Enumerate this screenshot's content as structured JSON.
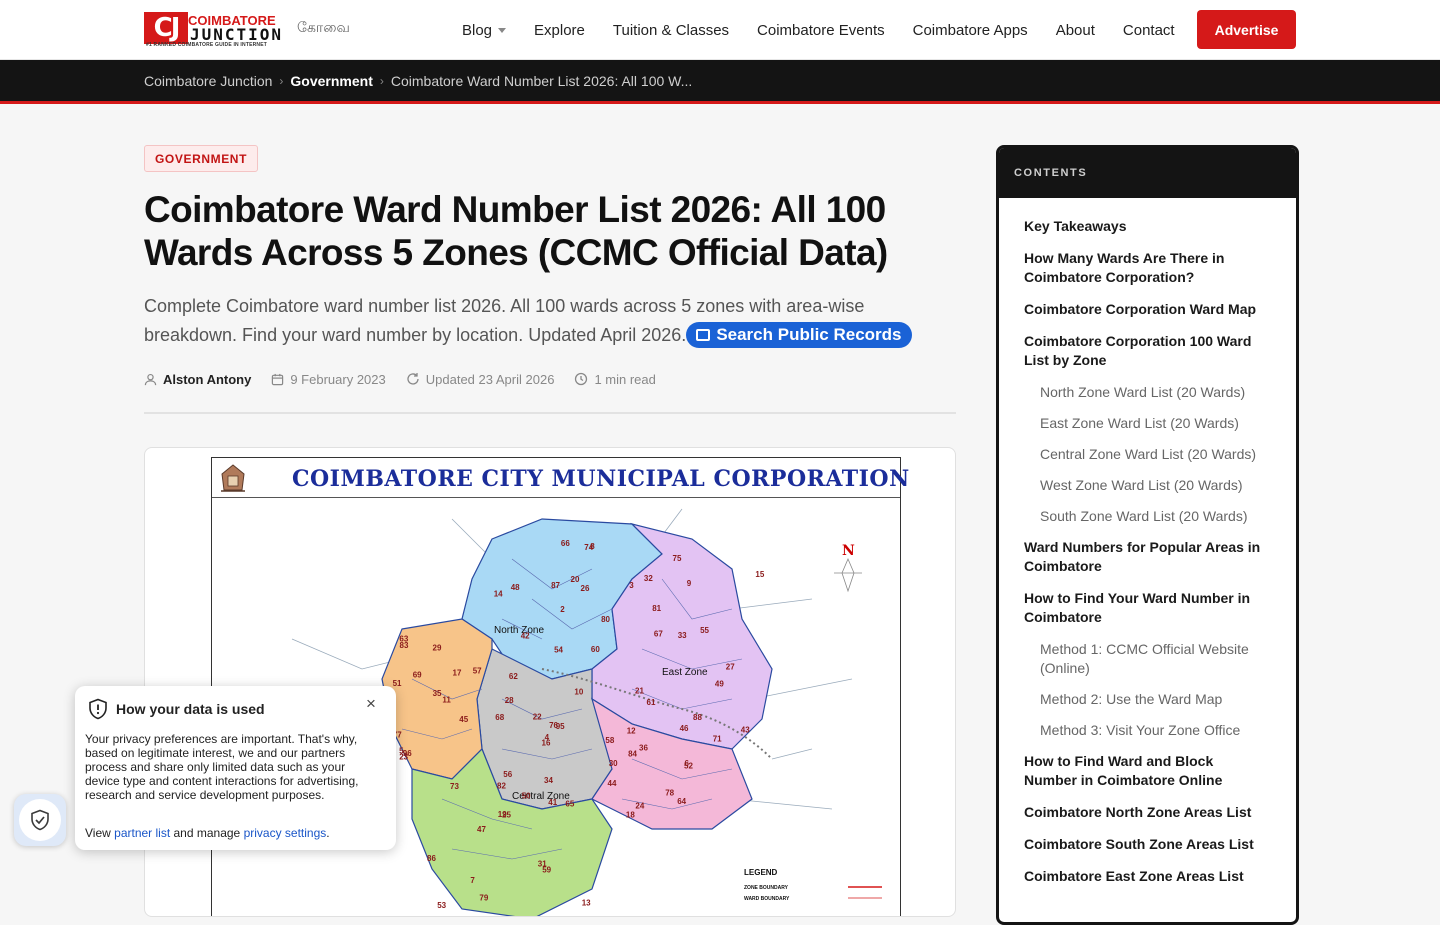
{
  "header": {
    "logo_top": "COIMBATORE",
    "logo_bottom": "JUNCTION",
    "logo_mark": "CJ",
    "logo_tagline": "#1 RANKED COIMBATORE GUIDE IN INTERNET",
    "logo_tamil": "கோவை",
    "nav": [
      {
        "label": "Blog",
        "has_dropdown": true
      },
      {
        "label": "Explore"
      },
      {
        "label": "Tuition & Classes"
      },
      {
        "label": "Coimbatore Events"
      },
      {
        "label": "Coimbatore Apps"
      },
      {
        "label": "About"
      },
      {
        "label": "Contact"
      }
    ],
    "advertise_label": "Advertise"
  },
  "breadcrumb": {
    "items": [
      "Coimbatore Junction",
      "Government",
      "Coimbatore Ward Number List 2026: All 100 W..."
    ]
  },
  "article": {
    "category": "GOVERNMENT",
    "title": "Coimbatore Ward Number List 2026: All 100 Wards Across 5 Zones (CCMC Official Data)",
    "intro": "Complete Coimbatore ward number list 2026. All 100 wards across 5 zones with area-wise breakdown. Find your ward number by location. Updated April 2026.",
    "search_button": "Search Public Records",
    "author": "Alston Antony",
    "published": "9 February 2023",
    "updated_label": "Updated",
    "updated": "23 April 2026",
    "read_time": "1 min read"
  },
  "map": {
    "title": "COIMBATORE CITY MUNICIPAL CORPORATION",
    "north": "N",
    "zones": [
      "North Zone",
      "East Zone",
      "Central Zone"
    ],
    "legend_title": "LEGEND",
    "legend_items": [
      "ZONE BOUNDARY",
      "WARD BOUNDARY"
    ],
    "ward_numbers": [
      "2",
      "3",
      "4",
      "5",
      "6",
      "7",
      "8",
      "9",
      "10",
      "11",
      "12",
      "13",
      "14",
      "15",
      "16",
      "17",
      "18",
      "19",
      "20",
      "21",
      "22",
      "23",
      "24",
      "25",
      "26",
      "27",
      "28",
      "29",
      "30",
      "31",
      "32",
      "33",
      "34",
      "35",
      "36",
      "41",
      "42",
      "43",
      "44",
      "45",
      "46",
      "47",
      "48",
      "49",
      "50",
      "51",
      "52",
      "53",
      "54",
      "55",
      "56",
      "57",
      "58",
      "59",
      "60",
      "61",
      "62",
      "63",
      "64",
      "65",
      "66",
      "67",
      "68",
      "69",
      "71",
      "73",
      "74",
      "75",
      "76",
      "77",
      "78",
      "79",
      "80",
      "81",
      "82",
      "83",
      "84",
      "86",
      "87",
      "88",
      "95",
      "96"
    ]
  },
  "toc": {
    "heading": "CONTENTS",
    "items": [
      {
        "label": "Key Takeaways",
        "level": 1
      },
      {
        "label": "How Many Wards Are There in Coimbatore Corporation?",
        "level": 1
      },
      {
        "label": "Coimbatore Corporation Ward Map",
        "level": 1
      },
      {
        "label": "Coimbatore Corporation 100 Ward List by Zone",
        "level": 1
      },
      {
        "label": "North Zone Ward List (20 Wards)",
        "level": 2
      },
      {
        "label": "East Zone Ward List (20 Wards)",
        "level": 2
      },
      {
        "label": "Central Zone Ward List (20 Wards)",
        "level": 2
      },
      {
        "label": "West Zone Ward List (20 Wards)",
        "level": 2
      },
      {
        "label": "South Zone Ward List (20 Wards)",
        "level": 2
      },
      {
        "label": "Ward Numbers for Popular Areas in Coimbatore",
        "level": 1
      },
      {
        "label": "How to Find Your Ward Number in Coimbatore",
        "level": 1
      },
      {
        "label": "Method 1: CCMC Official Website (Online)",
        "level": 2
      },
      {
        "label": "Method 2: Use the Ward Map",
        "level": 2
      },
      {
        "label": "Method 3: Visit Your Zone Office",
        "level": 2
      },
      {
        "label": "How to Find Ward and Block Number in Coimbatore Online",
        "level": 1
      },
      {
        "label": "Coimbatore North Zone Areas List",
        "level": 1
      },
      {
        "label": "Coimbatore South Zone Areas List",
        "level": 1
      },
      {
        "label": "Coimbatore East Zone Areas List",
        "level": 1
      }
    ]
  },
  "privacy": {
    "title": "How your data is used",
    "body": "Your privacy preferences are important. That's why, based on legitimate interest, we and our partners process and share only limited data such as your device type and content interactions for advertising, research and service development purposes.",
    "foot_prefix": "View ",
    "partner_link": "partner list",
    "foot_middle": " and manage ",
    "settings_link": "privacy settings",
    "foot_suffix": "."
  },
  "colors": {
    "brand_red": "#d51919",
    "dark": "#141414",
    "link_blue": "#1a62d6",
    "north_zone": "#a9d9f5",
    "east_zone": "#e3c3f3",
    "central_zone": "#c9c9c9",
    "west_zone": "#f7c489",
    "south_zone": "#b8e08a"
  }
}
